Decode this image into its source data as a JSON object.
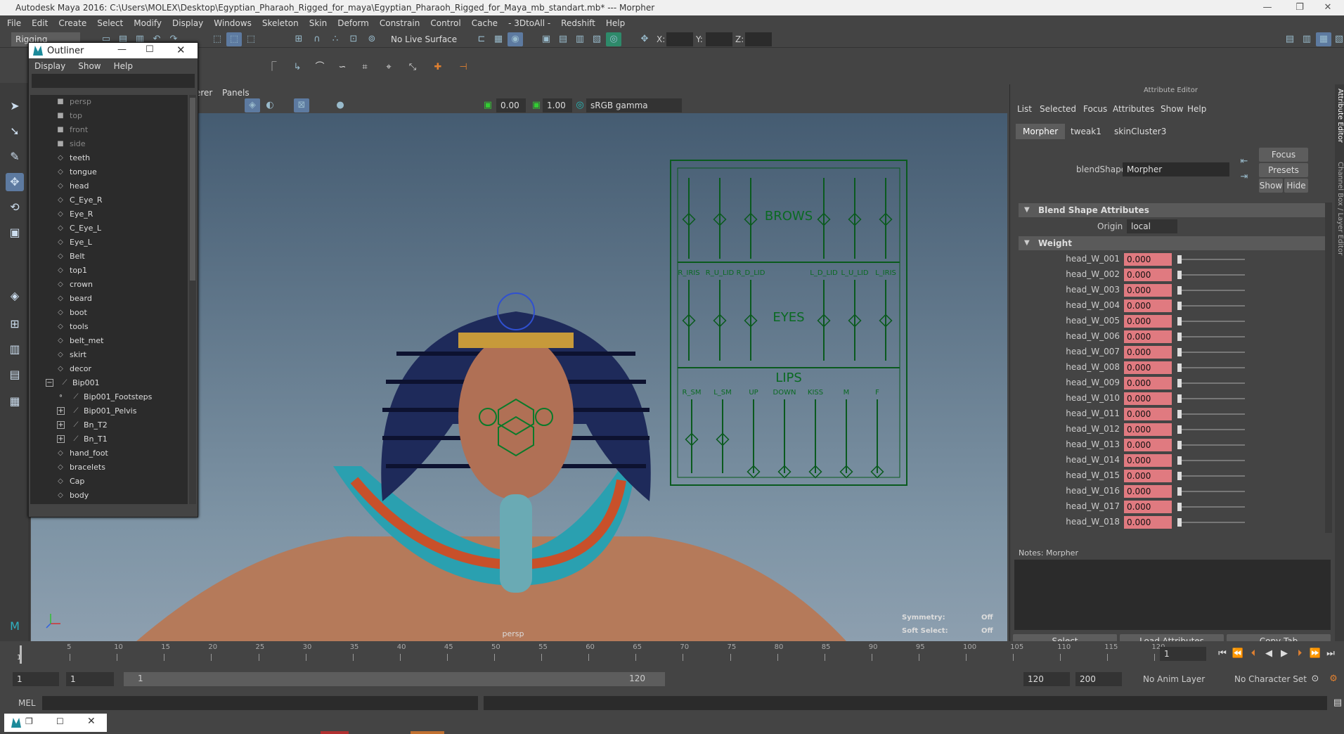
{
  "window": {
    "title": "Autodesk Maya 2016: C:\\Users\\MOLEX\\Desktop\\Egyptian_Pharaoh_Rigged_for_maya\\Egyptian_Pharaoh_Rigged_for_Maya_mb_standart.mb*   ---   Morpher"
  },
  "menubar": [
    "File",
    "Edit",
    "Create",
    "Select",
    "Modify",
    "Display",
    "Windows",
    "Skeleton",
    "Skin",
    "Deform",
    "Constrain",
    "Control",
    "Cache",
    "- 3DtoAll -",
    "Redshift",
    "Help"
  ],
  "statusline": {
    "menuset": "Rigging",
    "live_surface": "No Live Surface",
    "x_label": "X:",
    "y_label": "Y:",
    "z_label": "Z:"
  },
  "outliner": {
    "title": "Outliner",
    "menu": [
      "Display",
      "Show",
      "Help"
    ],
    "items": [
      {
        "label": "persp",
        "type": "cam",
        "indent": 0
      },
      {
        "label": "top",
        "type": "cam",
        "indent": 0
      },
      {
        "label": "front",
        "type": "cam",
        "indent": 0
      },
      {
        "label": "side",
        "type": "cam",
        "indent": 0
      },
      {
        "label": "teeth",
        "type": "mesh",
        "indent": 0
      },
      {
        "label": "tongue",
        "type": "mesh",
        "indent": 0
      },
      {
        "label": "head",
        "type": "mesh",
        "indent": 0
      },
      {
        "label": "C_Eye_R",
        "type": "mesh",
        "indent": 0
      },
      {
        "label": "Eye_R",
        "type": "mesh",
        "indent": 0
      },
      {
        "label": "C_Eye_L",
        "type": "mesh",
        "indent": 0
      },
      {
        "label": "Eye_L",
        "type": "mesh",
        "indent": 0
      },
      {
        "label": "Belt",
        "type": "mesh",
        "indent": 0
      },
      {
        "label": "top1",
        "type": "mesh",
        "indent": 0
      },
      {
        "label": "crown",
        "type": "mesh",
        "indent": 0
      },
      {
        "label": "beard",
        "type": "mesh",
        "indent": 0
      },
      {
        "label": "boot",
        "type": "mesh",
        "indent": 0
      },
      {
        "label": "tools",
        "type": "mesh",
        "indent": 0
      },
      {
        "label": "belt_met",
        "type": "mesh",
        "indent": 0
      },
      {
        "label": "skirt",
        "type": "mesh",
        "indent": 0
      },
      {
        "label": "decor",
        "type": "mesh",
        "indent": 0
      },
      {
        "label": "Bip001",
        "type": "joint",
        "indent": 1,
        "expander": "−"
      },
      {
        "label": "Bip001_Footsteps",
        "type": "joint",
        "indent": 2,
        "expander": ""
      },
      {
        "label": "Bip001_Pelvis",
        "type": "joint",
        "indent": 2,
        "expander": "+"
      },
      {
        "label": "Bn_T2",
        "type": "joint",
        "indent": 2,
        "expander": "+"
      },
      {
        "label": "Bn_T1",
        "type": "joint",
        "indent": 2,
        "expander": "+"
      },
      {
        "label": "hand_foot",
        "type": "mesh",
        "indent": 0
      },
      {
        "label": "bracelets",
        "type": "mesh",
        "indent": 0
      },
      {
        "label": "Cap",
        "type": "mesh",
        "indent": 0
      },
      {
        "label": "body",
        "type": "mesh",
        "indent": 0
      }
    ]
  },
  "viewport": {
    "panel_menu": [
      "erer",
      "Panels"
    ],
    "exposure": "0.00",
    "gamma": "1.00",
    "color_space": "sRGB gamma",
    "camera": "persp",
    "symmetry_label": "Symmetry:",
    "symmetry_value": "Off",
    "soft_select_label": "Soft Select:",
    "soft_select_value": "Off",
    "rig_labels": {
      "brows": "BROWS",
      "eyes": "EYES",
      "lips": "LIPS",
      "eye_ctrls": [
        "R_IRIS",
        "R_U_LID",
        "R_D_LID",
        "L_D_LID",
        "L_U_LID",
        "L_IRIS"
      ],
      "lip_ctrls": [
        "R_SM",
        "L_SM",
        "UP",
        "DOWN",
        "KISS",
        "M",
        "F"
      ]
    }
  },
  "attribute_editor": {
    "title": "Attribute Editor",
    "menu": [
      "List",
      "Selected",
      "Focus",
      "Attributes",
      "Show",
      "Help"
    ],
    "tabs": [
      "Morpher",
      "tweak1",
      "skinCluster3"
    ],
    "blendshape_label": "blendShape:",
    "blendshape_value": "Morpher",
    "focus_btn": "Focus",
    "presets_btn": "Presets",
    "show_btn": "Show",
    "hide_btn": "Hide",
    "section_blend": "Blend Shape Attributes",
    "origin_label": "Origin",
    "origin_value": "local",
    "section_weight": "Weight",
    "weights": [
      {
        "name": "head_W_001",
        "value": "0.000"
      },
      {
        "name": "head_W_002",
        "value": "0.000"
      },
      {
        "name": "head_W_003",
        "value": "0.000"
      },
      {
        "name": "head_W_004",
        "value": "0.000"
      },
      {
        "name": "head_W_005",
        "value": "0.000"
      },
      {
        "name": "head_W_006",
        "value": "0.000"
      },
      {
        "name": "head_W_007",
        "value": "0.000"
      },
      {
        "name": "head_W_008",
        "value": "0.000"
      },
      {
        "name": "head_W_009",
        "value": "0.000"
      },
      {
        "name": "head_W_010",
        "value": "0.000"
      },
      {
        "name": "head_W_011",
        "value": "0.000"
      },
      {
        "name": "head_W_012",
        "value": "0.000"
      },
      {
        "name": "head_W_013",
        "value": "0.000"
      },
      {
        "name": "head_W_014",
        "value": "0.000"
      },
      {
        "name": "head_W_015",
        "value": "0.000"
      },
      {
        "name": "head_W_016",
        "value": "0.000"
      },
      {
        "name": "head_W_017",
        "value": "0.000"
      },
      {
        "name": "head_W_018",
        "value": "0.000"
      }
    ],
    "notes_label": "Notes:  Morpher",
    "select_btn": "Select",
    "load_btn": "Load Attributes",
    "copy_btn": "Copy Tab",
    "side_tabs": [
      "Attribute Editor",
      "Channel Box / Layer Editor"
    ]
  },
  "timeline": {
    "ticks": [
      "5",
      "10",
      "15",
      "20",
      "25",
      "30",
      "35",
      "40",
      "45",
      "50",
      "55",
      "60",
      "65",
      "70",
      "75",
      "80",
      "85",
      "90",
      "95",
      "100",
      "105",
      "110",
      "115",
      "120"
    ],
    "first_frame_label": "1",
    "current_frame": "1"
  },
  "range": {
    "start": "1",
    "playback_start": "1",
    "slider_start": "1",
    "slider_end": "120",
    "playback_end": "120",
    "end": "200",
    "anim_layer": "No Anim Layer",
    "character_set": "No Character Set"
  },
  "cmdline": {
    "label": "MEL"
  }
}
